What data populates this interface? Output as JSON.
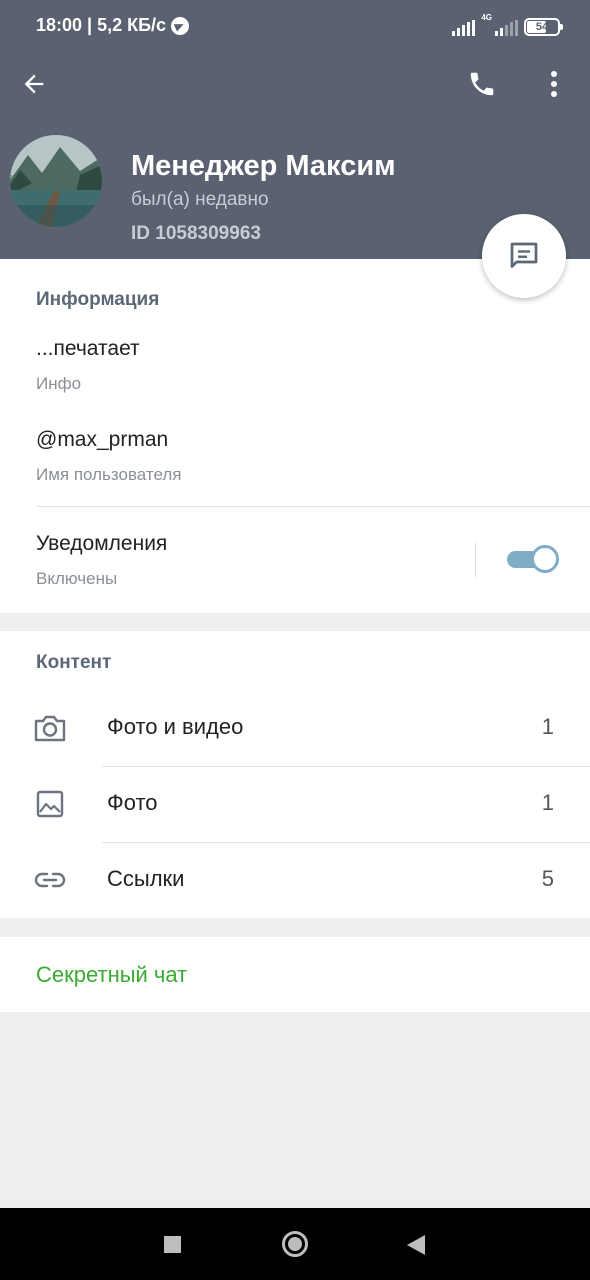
{
  "status_bar": {
    "time_speed": "18:00 | 5,2 КБ/с",
    "network": "4G",
    "battery": "54"
  },
  "profile": {
    "name": "Менеджер Максим",
    "status": "был(а) недавно",
    "id": "ID 1058309963"
  },
  "info": {
    "title": "Информация",
    "bio_value": "...печатает",
    "bio_label": "Инфо",
    "username_value": "@max_prman",
    "username_label": "Имя пользователя",
    "notifications_title": "Уведомления",
    "notifications_state": "Включены"
  },
  "content": {
    "title": "Контент",
    "items": [
      {
        "label": "Фото и видео",
        "count": "1",
        "icon": "camera-icon"
      },
      {
        "label": "Фото",
        "count": "1",
        "icon": "image-icon"
      },
      {
        "label": "Ссылки",
        "count": "5",
        "icon": "link-icon"
      }
    ]
  },
  "secret_chat": "Секретный чат",
  "colors": {
    "header": "#5a6170",
    "accent_green": "#3bab31",
    "toggle": "#80adc6"
  }
}
